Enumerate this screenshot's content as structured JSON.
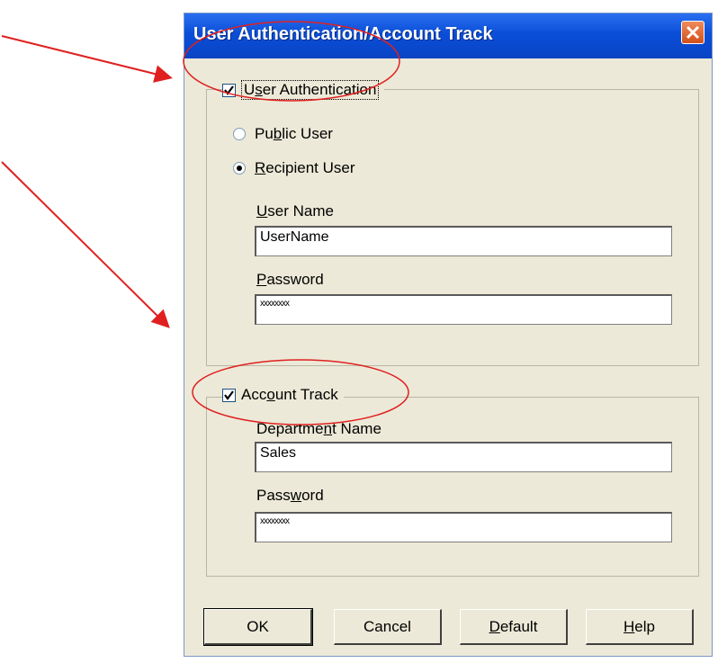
{
  "dialog": {
    "title": "User Authentication/Account Track"
  },
  "user_auth": {
    "label_pre": "U",
    "label_u": "s",
    "label_post": "er Authentication",
    "checked": true,
    "radio_public": {
      "pre": "Pu",
      "u": "b",
      "post": "lic User",
      "selected": false
    },
    "radio_recipient": {
      "pre": "",
      "u": "R",
      "post": "ecipient User",
      "selected": true
    },
    "username_label": {
      "pre": "",
      "u": "U",
      "post": "ser Name"
    },
    "username_value": "UserName",
    "password_label": {
      "pre": "",
      "u": "P",
      "post": "assword"
    },
    "password_value": "xxxxxxxx"
  },
  "account_track": {
    "label_pre": "Acc",
    "label_u": "o",
    "label_post": "unt Track",
    "checked": true,
    "department_label": {
      "pre": "Departme",
      "u": "n",
      "post": "t Name"
    },
    "department_value": "Sales",
    "password_label": {
      "pre": "Pass",
      "u": "w",
      "post": "ord"
    },
    "password_value": "xxxxxxxx"
  },
  "buttons": {
    "ok": "OK",
    "cancel": "Cancel",
    "default": {
      "pre": "",
      "u": "D",
      "post": "efault"
    },
    "help": {
      "pre": "",
      "u": "H",
      "post": "elp"
    }
  },
  "colors": {
    "annotation": "#e02020",
    "titlebar": "#0a4ed8",
    "dialog_bg": "#ece9d8"
  }
}
